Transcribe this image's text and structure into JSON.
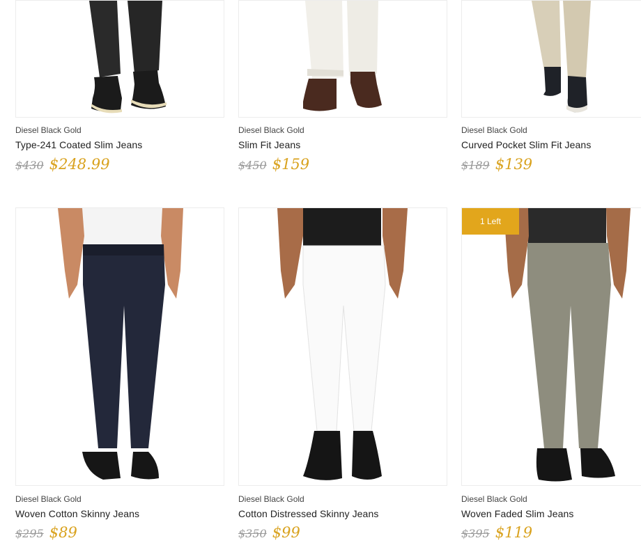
{
  "products": [
    {
      "brand": "Diesel Black Gold",
      "name": "Type-241 Coated Slim Jeans",
      "original_price": "$430",
      "sale_price": "$248.99"
    },
    {
      "brand": "Diesel Black Gold",
      "name": "Slim Fit Jeans",
      "original_price": "$450",
      "sale_price": "$159"
    },
    {
      "brand": "Diesel Black Gold",
      "name": "Curved Pocket Slim Fit Jeans",
      "original_price": "$189",
      "sale_price": "$139"
    },
    {
      "brand": "Diesel Black Gold",
      "name": "Woven Cotton Skinny Jeans",
      "original_price": "$295",
      "sale_price": "$89"
    },
    {
      "brand": "Diesel Black Gold",
      "name": "Cotton Distressed Skinny Jeans",
      "original_price": "$350",
      "sale_price": "$99"
    },
    {
      "brand": "Diesel Black Gold",
      "name": "Woven Faded Slim Jeans",
      "original_price": "$395",
      "sale_price": "$119",
      "badge": "1 Left"
    }
  ],
  "colors": {
    "accent": "#d9a21e",
    "badge": "#e2a61c",
    "strike": "#999999"
  }
}
